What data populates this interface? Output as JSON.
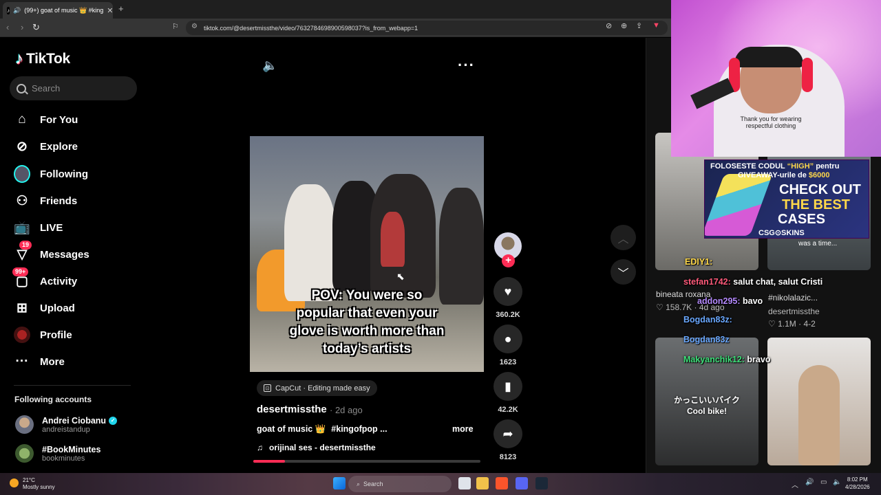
{
  "browser": {
    "tab_title": "(99+) goat of music 👑 #king",
    "tab_close": "✕",
    "new_tab": "+",
    "url": "tiktok.com/@desertmissthe/video/7632784698900598037?is_from_webapp=1"
  },
  "sidebar": {
    "logo": "TikTok",
    "search_placeholder": "Search",
    "nav": [
      {
        "label": "For You"
      },
      {
        "label": "Explore"
      },
      {
        "label": "Following"
      },
      {
        "label": "Friends"
      },
      {
        "label": "LIVE"
      },
      {
        "label": "Messages",
        "badge": "19"
      },
      {
        "label": "Activity",
        "badge": "99+"
      },
      {
        "label": "Upload"
      },
      {
        "label": "Profile"
      },
      {
        "label": "More"
      }
    ],
    "following_title": "Following accounts",
    "accounts": [
      {
        "name": "Andrei Ciobanu",
        "username": "andreistandup",
        "verified": true
      },
      {
        "name": "#BookMinutes",
        "username": "bookminutes"
      }
    ]
  },
  "video": {
    "caption_lines": [
      "POV: You were so",
      "popular that even your",
      "glove is worth more than",
      "today’s artists"
    ],
    "capcut": "CapCut · Editing made easy",
    "author": "desertmissthe",
    "posted": "· 2d ago",
    "description": "goat of music 👑",
    "hashtag": "#kingofpop ...",
    "more": "more",
    "music": "orijinal ses - desertmissthe",
    "progress": 0.14
  },
  "actions": {
    "likes": "360.2K",
    "comments": "1623",
    "saves": "42.2K",
    "shares": "8123"
  },
  "right_panel": {
    "items": [
      {
        "title": "bineata roxana",
        "likes": "158.7K",
        "ago": "4d ago"
      },
      {
        "title": "#nikolalazic...",
        "author": "desertmissthe",
        "likes": "1.1M",
        "ago": "4-2"
      },
      {
        "overlay": "かっこいいバイク\nCool bike!"
      }
    ],
    "thumb_text": "was a time..."
  },
  "stream_overlay": {
    "ad": {
      "line1a": "FOLOSESTE CODUL ",
      "line1b": "“HIGH”",
      "line1c": " pentru",
      "line2a": "GIVEAWAY-urile de ",
      "line2b": "$6000",
      "check": "CHECK OUT",
      "best": "THE BEST",
      "cases": "CASES",
      "brand": "CSG⊙SKINS"
    },
    "chat": [
      {
        "user": "EDIY1:",
        "msg": "",
        "color": "#ffd84a"
      },
      {
        "user": "stefan1742:",
        "msg": " salut chat, salut Cristi",
        "color": "#ff5a7a"
      },
      {
        "user": "addon295:",
        "msg": " bavo",
        "color": "#b58aff"
      },
      {
        "user": "Bogdan83z:",
        "msg": "",
        "color": "#6aa8ff"
      },
      {
        "user": "Bogdan83z",
        "msg": "",
        "color": "#6aa8ff"
      },
      {
        "user": "Makyanchik12:",
        "msg": " bravo",
        "color": "#3ee07a"
      }
    ],
    "webcam_shirt_text": "Thank you for wearing\nrespectful clothing"
  },
  "taskbar": {
    "temp": "21°C",
    "weather": "Mostly sunny",
    "search": "Search",
    "time": "8:02 PM",
    "date": "4/28/2026"
  }
}
